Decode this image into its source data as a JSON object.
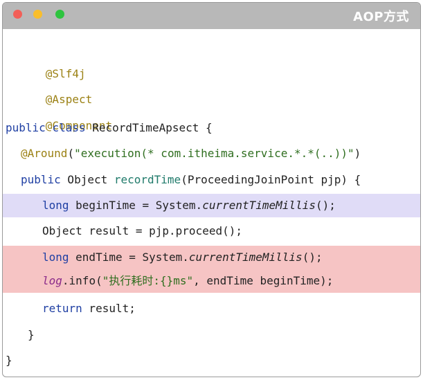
{
  "window": {
    "title": "AOP方式"
  },
  "code": {
    "line1": "@Slf4j",
    "line2": "@Aspect",
    "line3": "@Component",
    "line4_kw1": "public",
    "line4_kw2": "class",
    "line4_rest": " RecordTimeApsect {",
    "line5_ann": "@Around",
    "line5_p1": "(",
    "line5_str": "\"execution(* com.itheima.service.*.*(..))\"",
    "line5_p2": ")",
    "line6_kw": "public",
    "line6_type": " Object ",
    "line6_method": "recordTime",
    "line6_rest": "(ProceedingJoinPoint pjp) {",
    "line7_kw": "long",
    "line7_mid": " beginTime = System.",
    "line7_call": "currentTimeMillis",
    "line7_end": "();",
    "line8": "Object result = pjp.proceed();",
    "line9_kw": "long",
    "line9_mid": " endTime = System.",
    "line9_call": "currentTimeMillis",
    "line9_end": "();",
    "line10_field": "log",
    "line10_mid": ".info(",
    "line10_str": "\"执行耗时:{}ms\"",
    "line10_end": ", endTime beginTime);",
    "line11_kw": "return",
    "line11_rest": " result;",
    "line12": "}",
    "line13": "}"
  }
}
